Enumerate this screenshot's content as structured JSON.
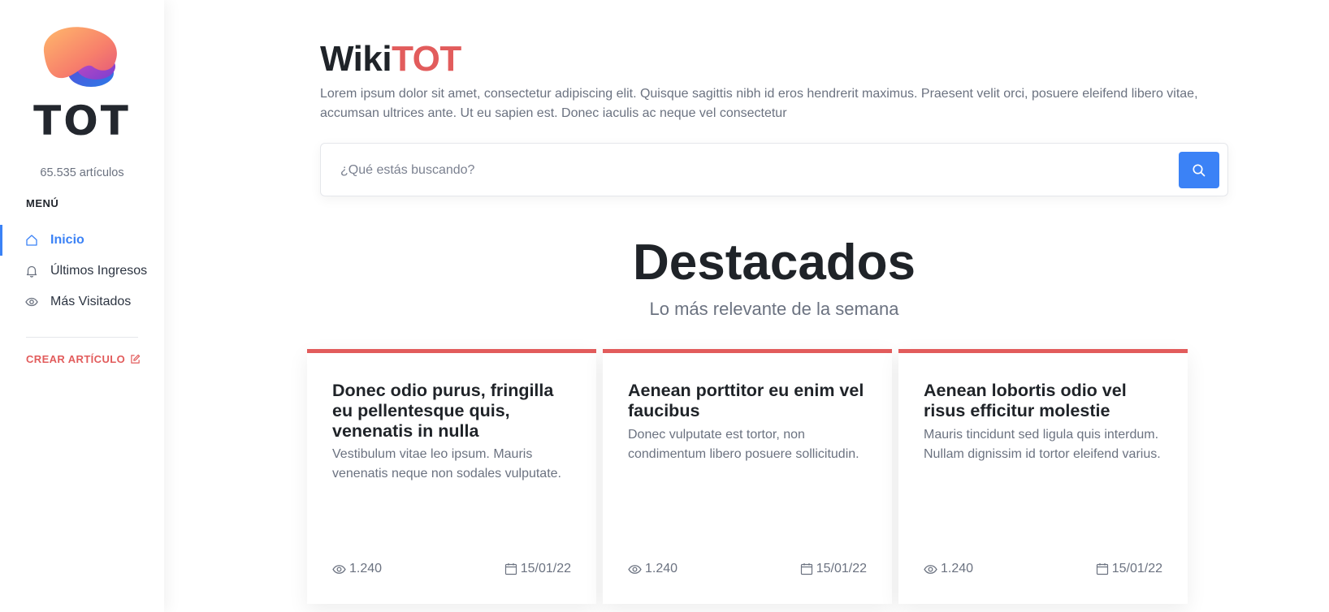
{
  "sidebar": {
    "logo_text": "TOT",
    "article_count": "65.535 artículos",
    "menu_heading": "MENÚ",
    "menu_items": [
      {
        "label": "Inicio",
        "icon": "home-icon",
        "active": true
      },
      {
        "label": "Últimos Ingresos",
        "icon": "bell-icon",
        "active": false
      },
      {
        "label": "Más Visitados",
        "icon": "eye-icon",
        "active": false
      }
    ],
    "create_label": "CREAR ARTÍCULO"
  },
  "header": {
    "title_part1": "Wiki",
    "title_part2": "TOT",
    "intro": "Lorem ipsum dolor sit amet, consectetur adipiscing elit. Quisque sagittis nibh id eros hendrerit maximus. Praesent velit orci, posuere eleifend libero vitae, accumsan ultrices ante. Ut eu sapien est. Donec iaculis ac neque vel consectetur"
  },
  "search": {
    "placeholder": "¿Qué estás buscando?",
    "value": ""
  },
  "featured": {
    "title": "Destacados",
    "subtitle": "Lo más relevante de la semana",
    "cards": [
      {
        "title": "Donec odio purus, fringilla eu pellentesque quis, venenatis in nulla",
        "description": "Vestibulum vitae leo ipsum. Mauris venenatis neque non sodales vulputate.",
        "views": "1.240",
        "date": "15/01/22"
      },
      {
        "title": "Aenean porttitor eu enim vel faucibus",
        "description": "Donec vulputate est tortor, non condimentum libero posuere sollicitudin.",
        "views": "1.240",
        "date": "15/01/22"
      },
      {
        "title": "Aenean lobortis odio vel risus efficitur molestie",
        "description": "Mauris tincidunt sed ligula quis interdum. Nullam dignissim id tortor eleifend varius.",
        "views": "1.240",
        "date": "15/01/22"
      }
    ]
  },
  "colors": {
    "accent_blue": "#3b82f6",
    "accent_red": "#e25c5c",
    "text_dark": "#1f2328",
    "text_muted": "#6b7280"
  }
}
